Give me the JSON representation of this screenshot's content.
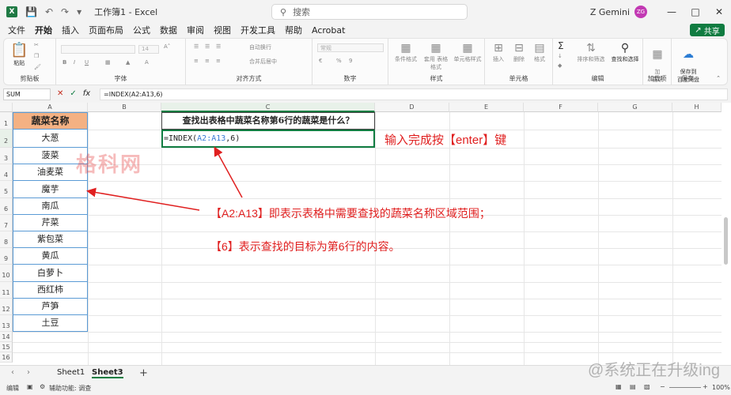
{
  "titlebar": {
    "qa_icons": [
      "save-icon",
      "undo-icon",
      "redo-icon",
      "customize-icon"
    ],
    "doc_title": "工作簿1 - Excel",
    "search_placeholder": "搜索",
    "user_name": "Z Gemini",
    "user_initials": "ZG"
  },
  "menu": {
    "items": [
      "文件",
      "开始",
      "插入",
      "页面布局",
      "公式",
      "数据",
      "审阅",
      "视图",
      "开发工具",
      "帮助",
      "Acrobat"
    ],
    "active": "开始",
    "share_label": "共享"
  },
  "ribbon": {
    "groups": [
      "剪贴板",
      "字体",
      "对齐方式",
      "数字",
      "样式",
      "单元格",
      "编辑",
      "加载项",
      "保存"
    ],
    "paste_label": "粘贴",
    "font_size": "14",
    "wrap_text": "自动换行",
    "merge_center": "合并后居中",
    "number_format": "常规",
    "styles_buttons": [
      "条件格式",
      "套用\n表格格式",
      "单元格样式"
    ],
    "cells_buttons": [
      "插入",
      "删除",
      "格式"
    ],
    "edit_buttons": [
      "排序和筛选",
      "查找和选择"
    ],
    "addins_label": "加\n载项",
    "save_label": "保存到\n百度网盘"
  },
  "formula_bar": {
    "name_box": "SUM",
    "formula": "=INDEX(A2:A13,6)"
  },
  "columns": [
    "A",
    "B",
    "C",
    "D",
    "E",
    "F",
    "G",
    "H"
  ],
  "rows": [
    "1",
    "2",
    "3",
    "4",
    "5",
    "6",
    "7",
    "8",
    "9",
    "10",
    "11",
    "12",
    "13",
    "14",
    "15",
    "16"
  ],
  "table": {
    "header": "蔬菜名称",
    "items": [
      "大葱",
      "菠菜",
      "油麦菜",
      "魔芋",
      "南瓜",
      "芹菜",
      "紫包菜",
      "黄瓜",
      "白萝卜",
      "西红柿",
      "芦笋",
      "土豆"
    ]
  },
  "cells": {
    "c1": "查找出表格中蔬菜名称第6行的蔬菜是什么？",
    "c2_prefix": "=INDEX(",
    "c2_ref": "A2:A13",
    "c2_suffix": ",6)"
  },
  "annotations": {
    "enter_note": "输入完成按【enter】键",
    "range_note": "【A2:A13】即表示表格中需要查找的蔬菜名称区域范围；",
    "row_note": "【6】表示查找的目标为第6行的内容。",
    "watermark": "格科网",
    "corner_watermark": "@系统正在升级ing"
  },
  "sheets": {
    "tabs": [
      "Sheet1",
      "Sheet3"
    ],
    "active": "Sheet3"
  },
  "status": {
    "mode": "编辑",
    "accessibility": "辅助功能: 调查",
    "zoom": "100%"
  },
  "colors": {
    "excel_green": "#107c41",
    "header_fill": "#f4b183",
    "table_border": "#5b9bd5",
    "annotation_red": "#e02020",
    "ref_blue": "#3a7bd5"
  }
}
